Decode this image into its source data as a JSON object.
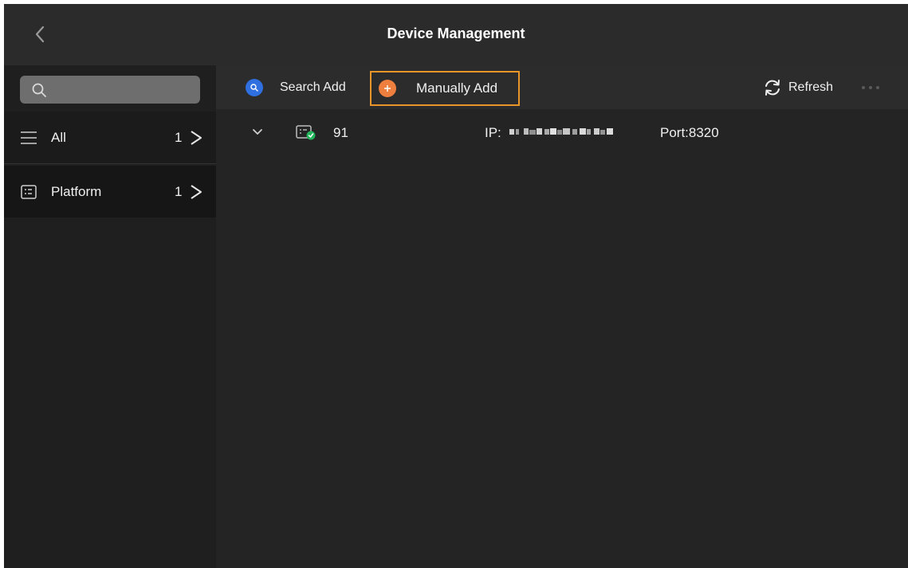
{
  "header": {
    "title": "Device Management",
    "back_icon": "chevron-left-icon"
  },
  "sidebar": {
    "search": {
      "placeholder": "",
      "value": "",
      "icon": "search-icon"
    },
    "items": [
      {
        "label": "All",
        "count": "1",
        "icon": "menu-icon",
        "chevron": ">"
      },
      {
        "label": "Platform",
        "count": "1",
        "icon": "platform-icon",
        "chevron": ">"
      }
    ]
  },
  "toolbar": {
    "search_add_label": "Search Add",
    "manual_add_label": "Manually Add",
    "refresh_label": "Refresh",
    "more_icon": "more-dots-icon"
  },
  "devices": [
    {
      "name": "91",
      "ip_label": "IP:",
      "port": "Port:8320",
      "status": "online"
    }
  ],
  "colors": {
    "search_add_accent": "#2f6fe0",
    "manual_add_accent": "#ef7f3e",
    "highlight_border": "#e9952a",
    "online_status": "#22b35a"
  }
}
